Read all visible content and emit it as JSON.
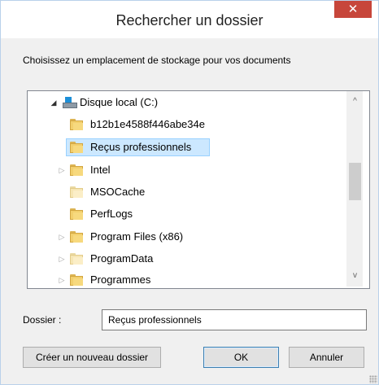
{
  "window": {
    "title": "Rechercher un dossier",
    "close_glyph": "✕"
  },
  "description": "Choisissez un emplacement de stockage pour vos documents",
  "tree": {
    "items": [
      {
        "label": "Disque local (C:)",
        "icon": "drive-icon",
        "arrow": "expanded"
      },
      {
        "label": "b12b1e4588f446abe34e",
        "icon": "folder-icon",
        "arrow": "none"
      },
      {
        "label": "Reçus professionnels",
        "icon": "folder-icon",
        "arrow": "none",
        "selected": true
      },
      {
        "label": "Intel",
        "icon": "folder-icon",
        "arrow": "collapsed"
      },
      {
        "label": "MSOCache",
        "icon": "folder-icon-pale",
        "arrow": "none"
      },
      {
        "label": "PerfLogs",
        "icon": "folder-icon",
        "arrow": "none"
      },
      {
        "label": "Program Files (x86)",
        "icon": "folder-icon",
        "arrow": "collapsed"
      },
      {
        "label": "ProgramData",
        "icon": "folder-icon-pale",
        "arrow": "collapsed"
      },
      {
        "label": "Programmes",
        "icon": "folder-icon",
        "arrow": "collapsed"
      }
    ],
    "arrow_expanded": "◢",
    "arrow_collapsed": "▷"
  },
  "scrollbar": {
    "up_glyph": "^",
    "down_glyph": "v"
  },
  "folder_field": {
    "label": "Dossier :",
    "value": "Reçus professionnels"
  },
  "buttons": {
    "new_folder": "Créer un nouveau dossier",
    "ok": "OK",
    "cancel": "Annuler"
  },
  "colors": {
    "selection_bg": "#cce8ff",
    "close_button": "#c7463b"
  }
}
